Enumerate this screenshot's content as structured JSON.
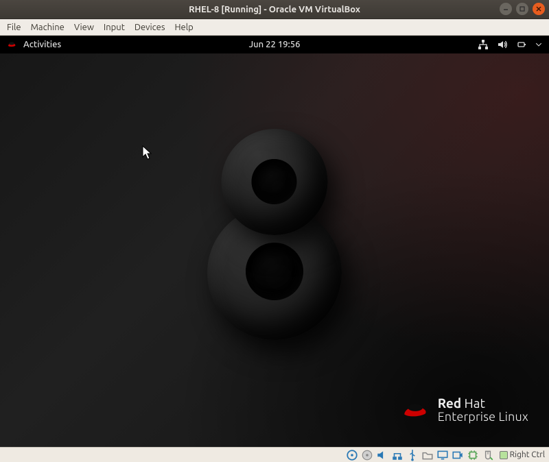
{
  "window": {
    "title": "RHEL-8 [Running] - Oracle VM VirtualBox"
  },
  "menubar": {
    "items": [
      "File",
      "Machine",
      "View",
      "Input",
      "Devices",
      "Help"
    ]
  },
  "gnome": {
    "activities": "Activities",
    "clock": "Jun 22  19:56"
  },
  "brand": {
    "name_strong": "Red",
    "name_rest": " Hat",
    "tagline": "Enterprise Linux"
  },
  "statusbar": {
    "host_key": "Right Ctrl"
  }
}
